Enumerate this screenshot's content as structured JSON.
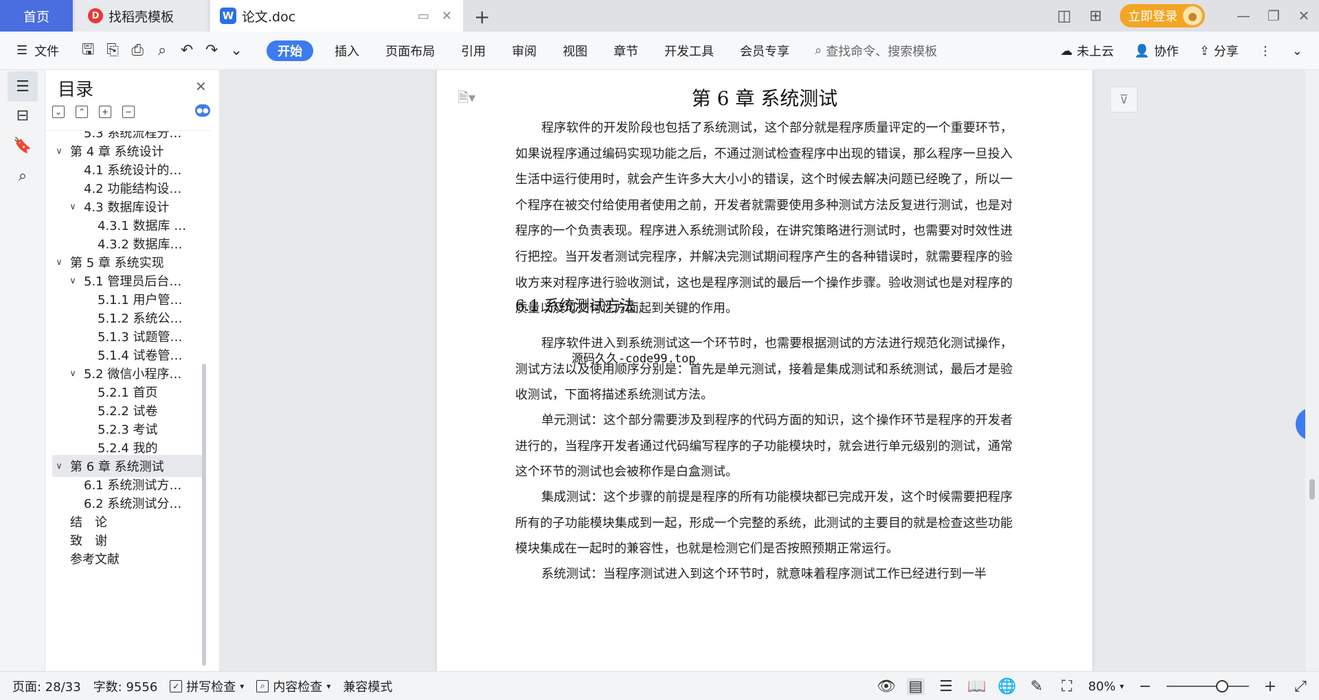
{
  "tabs": {
    "home": "首页",
    "daoke": "找稻壳模板",
    "doc": "论文.doc"
  },
  "titlebar": {
    "login": "立即登录"
  },
  "toolbar": {
    "file": "文件",
    "ribbon": [
      "开始",
      "插入",
      "页面布局",
      "引用",
      "审阅",
      "视图",
      "章节",
      "开发工具",
      "会员专享"
    ],
    "search_placeholder": "查找命令、搜索模板",
    "cloud": "未上云",
    "collab": "协作",
    "share": "分享"
  },
  "toc": {
    "title": "目录",
    "items": [
      {
        "label": "5.3 系统流程分…",
        "level": 2,
        "chev": ""
      },
      {
        "label": "第 4 章 系统设计",
        "level": 1,
        "chev": "v"
      },
      {
        "label": "4.1 系统设计的…",
        "level": 2,
        "chev": ""
      },
      {
        "label": "4.2 功能结构设…",
        "level": 2,
        "chev": ""
      },
      {
        "label": "4.3 数据库设计",
        "level": 2,
        "chev": "v"
      },
      {
        "label": "4.3.1 数据库 …",
        "level": 3,
        "chev": ""
      },
      {
        "label": "4.3.2 数据库…",
        "level": 3,
        "chev": ""
      },
      {
        "label": "第 5 章 系统实现",
        "level": 1,
        "chev": "v"
      },
      {
        "label": "5.1 管理员后台…",
        "level": 2,
        "chev": "v"
      },
      {
        "label": "5.1.1 用户管…",
        "level": 3,
        "chev": ""
      },
      {
        "label": "5.1.2 系统公…",
        "level": 3,
        "chev": ""
      },
      {
        "label": "5.1.3 试题管…",
        "level": 3,
        "chev": ""
      },
      {
        "label": "5.1.4 试卷管…",
        "level": 3,
        "chev": ""
      },
      {
        "label": "5.2 微信小程序…",
        "level": 2,
        "chev": "v"
      },
      {
        "label": "5.2.1 首页",
        "level": 3,
        "chev": ""
      },
      {
        "label": "5.2.2 试卷",
        "level": 3,
        "chev": ""
      },
      {
        "label": "5.2.3 考试",
        "level": 3,
        "chev": ""
      },
      {
        "label": "5.2.4 我的",
        "level": 3,
        "chev": ""
      },
      {
        "label": "第 6 章 系统测试",
        "level": 1,
        "chev": "v",
        "selected": true
      },
      {
        "label": "6.1 系统测试方…",
        "level": 2,
        "chev": ""
      },
      {
        "label": "6.2 系统测试分…",
        "level": 2,
        "chev": ""
      },
      {
        "label": "结　论",
        "level": 1,
        "chev": ""
      },
      {
        "label": "致　谢",
        "level": 1,
        "chev": ""
      },
      {
        "label": "参考文献",
        "level": 1,
        "chev": ""
      }
    ]
  },
  "document": {
    "chapter_title": "第 6 章  系统测试",
    "para1": "程序软件的开发阶段也包括了系统测试，这个部分就是程序质量评定的一个重要环节，如果说程序通过编码实现功能之后，不通过测试检查程序中出现的错误，那么程序一旦投入生活中运行使用时，就会产生许多大大小小的错误，这个时候去解决问题已经晚了，所以一个程序在被交付给使用者使用之前，开发者就需要使用多种测试方法反复进行测试，也是对程序的一个负责表现。程序进入系统测试阶段，在讲究策略进行测试时，也需要对时效性进行把控。当开发者测试完程序，并解决完测试期间程序产生的各种错误时，就需要程序的验收方来对程序进行验收测试，这也是程序测试的最后一个操作步骤。验收测试也是对程序的质量以及可交付性方面起到关键的作用。",
    "watermark": "源码久久-code99.top",
    "section_title": "6.1 系统测试方法",
    "para2": "程序软件进入到系统测试这一个环节时，也需要根据测试的方法进行规范化测试操作，测试方法以及使用顺序分别是：首先是单元测试，接着是集成测试和系统测试，最后才是验收测试，下面将描述系统测试方法。",
    "para3": "单元测试：这个部分需要涉及到程序的代码方面的知识，这个操作环节是程序的开发者进行的，当程序开发者通过代码编写程序的子功能模块时，就会进行单元级别的测试，通常这个环节的测试也会被称作是白盒测试。",
    "para4": "集成测试：这个步骤的前提是程序的所有功能模块都已完成开发，这个时候需要把程序所有的子功能模块集成到一起，形成一个完整的系统，此测试的主要目的就是检查这些功能模块集成在一起时的兼容性，也就是检测它们是否按照预期正常运行。",
    "para5": "系统测试：当程序测试进入到这个环节时，就意味着程序测试工作已经进行到一半"
  },
  "statusbar": {
    "page": "页面: 28/33",
    "words": "字数: 9556",
    "spell": "拼写检查",
    "content": "内容检查",
    "compat": "兼容模式",
    "zoom": "80%"
  }
}
